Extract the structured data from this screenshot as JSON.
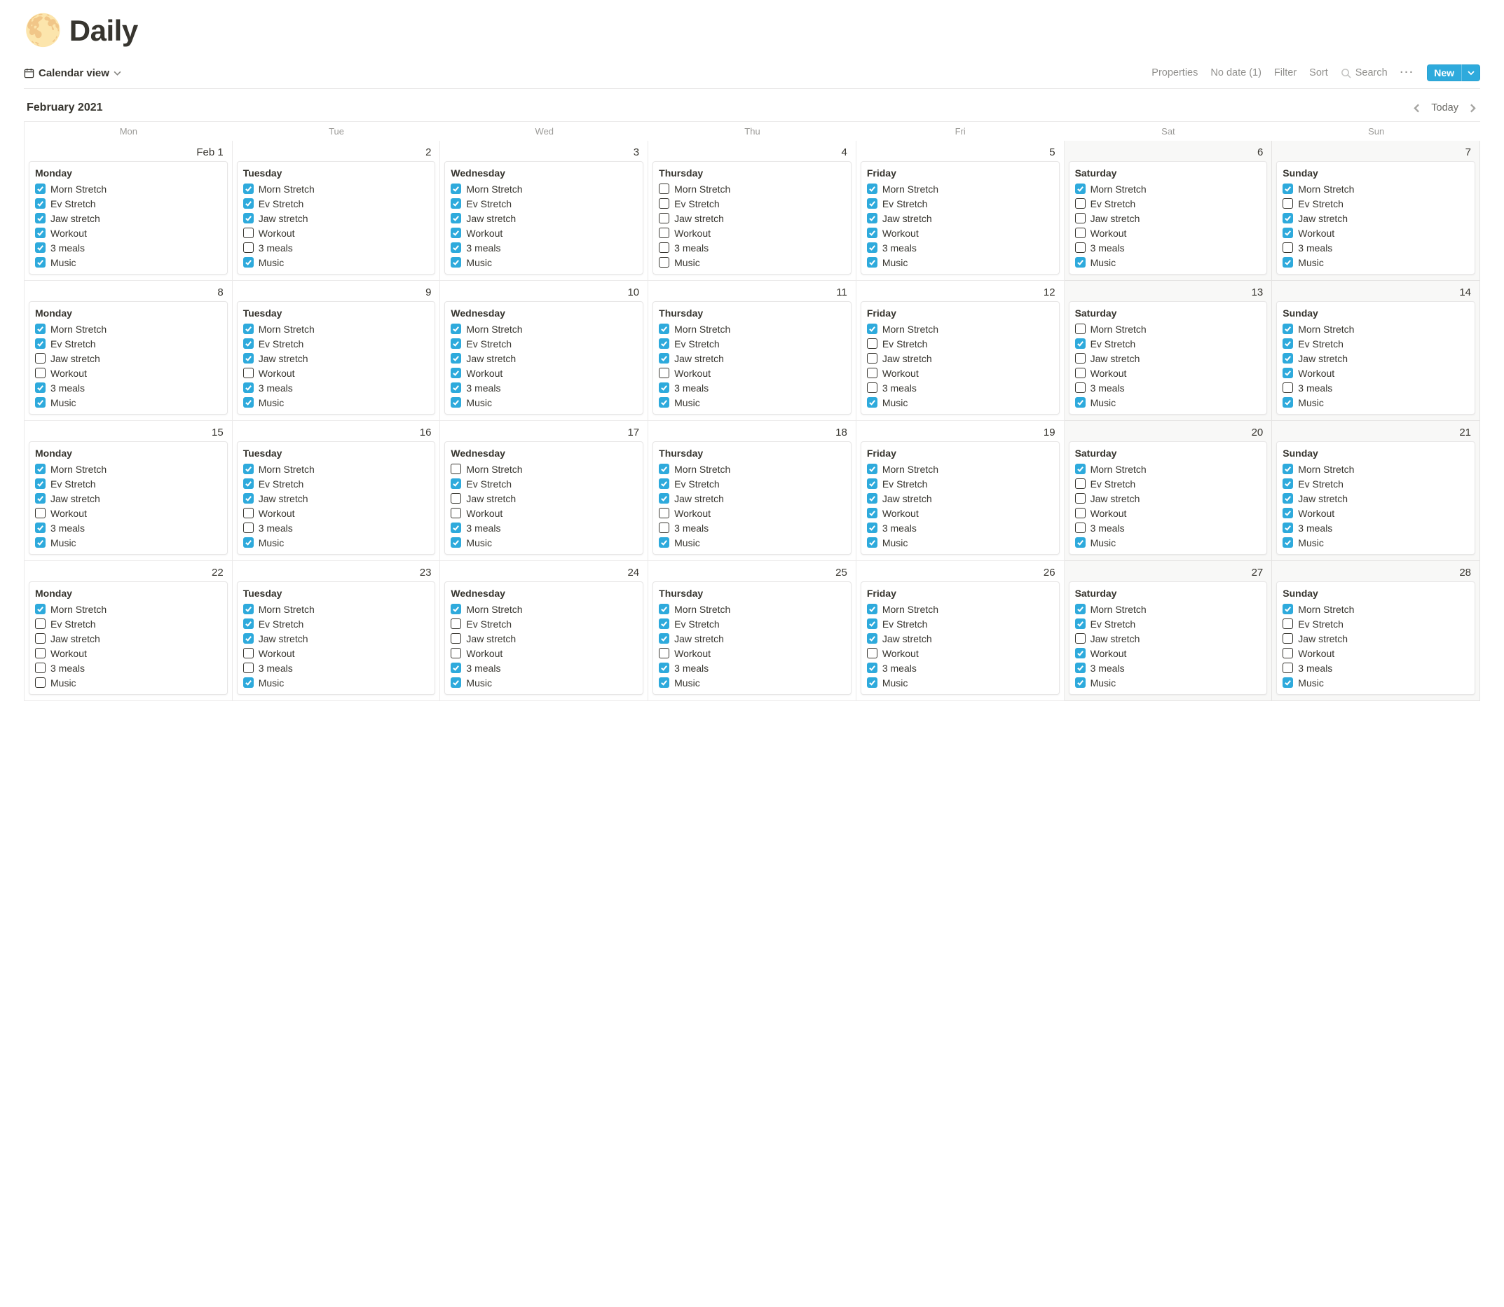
{
  "header": {
    "icon": "🌕",
    "title": "Daily"
  },
  "view": {
    "label": "Calendar view"
  },
  "toolbar": {
    "properties": "Properties",
    "nodate": "No date (1)",
    "filter": "Filter",
    "sort": "Sort",
    "search": "Search",
    "new": "New"
  },
  "calendar": {
    "month": "February 2021",
    "today": "Today",
    "dow": [
      "Mon",
      "Tue",
      "Wed",
      "Thu",
      "Fri",
      "Sat",
      "Sun"
    ],
    "tasks": [
      "Morn Stretch",
      "Ev Stretch",
      "Jaw stretch",
      "Workout",
      "3 meals",
      "Music"
    ],
    "weeks": [
      [
        {
          "num": "Feb 1",
          "weekend": false,
          "title": "Monday",
          "checks": [
            true,
            true,
            true,
            true,
            true,
            true
          ]
        },
        {
          "num": "2",
          "weekend": false,
          "title": "Tuesday",
          "checks": [
            true,
            true,
            true,
            false,
            false,
            true
          ]
        },
        {
          "num": "3",
          "weekend": false,
          "title": "Wednesday",
          "checks": [
            true,
            true,
            true,
            true,
            true,
            true
          ]
        },
        {
          "num": "4",
          "weekend": false,
          "title": "Thursday",
          "checks": [
            false,
            false,
            false,
            false,
            false,
            false
          ]
        },
        {
          "num": "5",
          "weekend": false,
          "title": "Friday",
          "checks": [
            true,
            true,
            true,
            true,
            true,
            true
          ]
        },
        {
          "num": "6",
          "weekend": true,
          "title": "Saturday",
          "checks": [
            true,
            false,
            false,
            false,
            false,
            true
          ]
        },
        {
          "num": "7",
          "weekend": true,
          "title": "Sunday",
          "checks": [
            true,
            false,
            true,
            true,
            false,
            true
          ]
        }
      ],
      [
        {
          "num": "8",
          "weekend": false,
          "title": "Monday",
          "checks": [
            true,
            true,
            false,
            false,
            true,
            true
          ]
        },
        {
          "num": "9",
          "weekend": false,
          "title": "Tuesday",
          "checks": [
            true,
            true,
            true,
            false,
            true,
            true
          ]
        },
        {
          "num": "10",
          "weekend": false,
          "title": "Wednesday",
          "checks": [
            true,
            true,
            true,
            true,
            true,
            true
          ]
        },
        {
          "num": "11",
          "weekend": false,
          "title": "Thursday",
          "checks": [
            true,
            true,
            true,
            false,
            true,
            true
          ]
        },
        {
          "num": "12",
          "weekend": false,
          "title": "Friday",
          "checks": [
            true,
            false,
            false,
            false,
            false,
            true
          ]
        },
        {
          "num": "13",
          "weekend": true,
          "title": "Saturday",
          "checks": [
            false,
            true,
            false,
            false,
            false,
            true
          ]
        },
        {
          "num": "14",
          "weekend": true,
          "title": "Sunday",
          "checks": [
            true,
            true,
            true,
            true,
            false,
            true
          ]
        }
      ],
      [
        {
          "num": "15",
          "weekend": false,
          "title": "Monday",
          "checks": [
            true,
            true,
            true,
            false,
            true,
            true
          ]
        },
        {
          "num": "16",
          "weekend": false,
          "title": "Tuesday",
          "checks": [
            true,
            true,
            true,
            false,
            false,
            true
          ]
        },
        {
          "num": "17",
          "weekend": false,
          "title": "Wednesday",
          "checks": [
            false,
            true,
            false,
            false,
            true,
            true
          ]
        },
        {
          "num": "18",
          "weekend": false,
          "title": "Thursday",
          "checks": [
            true,
            true,
            true,
            false,
            false,
            true
          ]
        },
        {
          "num": "19",
          "weekend": false,
          "title": "Friday",
          "checks": [
            true,
            true,
            true,
            true,
            true,
            true
          ]
        },
        {
          "num": "20",
          "weekend": true,
          "title": "Saturday",
          "checks": [
            true,
            false,
            false,
            false,
            false,
            true
          ]
        },
        {
          "num": "21",
          "weekend": true,
          "title": "Sunday",
          "checks": [
            true,
            true,
            true,
            true,
            true,
            true
          ]
        }
      ],
      [
        {
          "num": "22",
          "weekend": false,
          "title": "Monday",
          "checks": [
            true,
            false,
            false,
            false,
            false,
            false
          ]
        },
        {
          "num": "23",
          "weekend": false,
          "title": "Tuesday",
          "checks": [
            true,
            true,
            true,
            false,
            false,
            true
          ]
        },
        {
          "num": "24",
          "weekend": false,
          "title": "Wednesday",
          "checks": [
            true,
            false,
            false,
            false,
            true,
            true
          ]
        },
        {
          "num": "25",
          "weekend": false,
          "title": "Thursday",
          "checks": [
            true,
            true,
            true,
            false,
            true,
            true
          ]
        },
        {
          "num": "26",
          "weekend": false,
          "title": "Friday",
          "checks": [
            true,
            true,
            true,
            false,
            true,
            true
          ]
        },
        {
          "num": "27",
          "weekend": true,
          "title": "Saturday",
          "checks": [
            true,
            true,
            false,
            true,
            true,
            true
          ]
        },
        {
          "num": "28",
          "weekend": true,
          "title": "Sunday",
          "checks": [
            true,
            false,
            false,
            false,
            false,
            true
          ]
        }
      ]
    ]
  }
}
